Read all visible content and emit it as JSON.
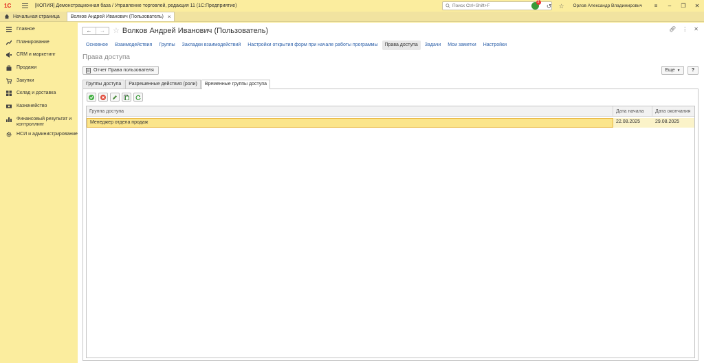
{
  "window": {
    "logo_text": "1С",
    "title": "[КОПИЯ] Демонстрационная база / Управление торговлей, редакция 11  (1С:Предприятие)",
    "search_placeholder": "Поиск Ctrl+Shift+F",
    "notification_count": "2",
    "user": "Орлов Александр Владимирович"
  },
  "tabs": {
    "home": "Начальная страница",
    "open": "Волков Андрей Иванович (Пользователь)"
  },
  "sidebar": {
    "items": [
      {
        "label": "Главное",
        "icon": "menu-icon"
      },
      {
        "label": "Планирование",
        "icon": "chart-icon"
      },
      {
        "label": "CRM и маркетинг",
        "icon": "megaphone-icon"
      },
      {
        "label": "Продажи",
        "icon": "bag-icon"
      },
      {
        "label": "Закупки",
        "icon": "cart-icon"
      },
      {
        "label": "Склад и доставка",
        "icon": "warehouse-icon"
      },
      {
        "label": "Казначейство",
        "icon": "cash-icon"
      },
      {
        "label": "Финансовый результат и контроллинг",
        "icon": "bar-chart-icon"
      },
      {
        "label": "НСИ и администрирование",
        "icon": "gear-icon"
      }
    ]
  },
  "form": {
    "title": "Волков Андрей Иванович (Пользователь)",
    "nav_links": [
      {
        "label": "Основное"
      },
      {
        "label": "Взаимодействия"
      },
      {
        "label": "Группы"
      },
      {
        "label": "Закладки взаимодействий"
      },
      {
        "label": "Настройки открытия форм при начале работы программы"
      },
      {
        "label": "Права доступа"
      },
      {
        "label": "Задачи"
      },
      {
        "label": "Мои заметки"
      },
      {
        "label": "Настройки"
      }
    ],
    "section_title": "Права доступа",
    "report_button": "Отчет Права пользователя",
    "more_button": "Еще",
    "help_button": "?",
    "inner_tabs": [
      {
        "label": "Группы доступа"
      },
      {
        "label": "Разрешенные действия (роли)"
      },
      {
        "label": "Временные группы доступа"
      }
    ],
    "table": {
      "headers": [
        "Группа доступа",
        "Дата начала",
        "Дата окончания"
      ],
      "rows": [
        [
          "Менеджер отдела продаж",
          "22.08.2025",
          "29.08.2025"
        ]
      ]
    }
  }
}
